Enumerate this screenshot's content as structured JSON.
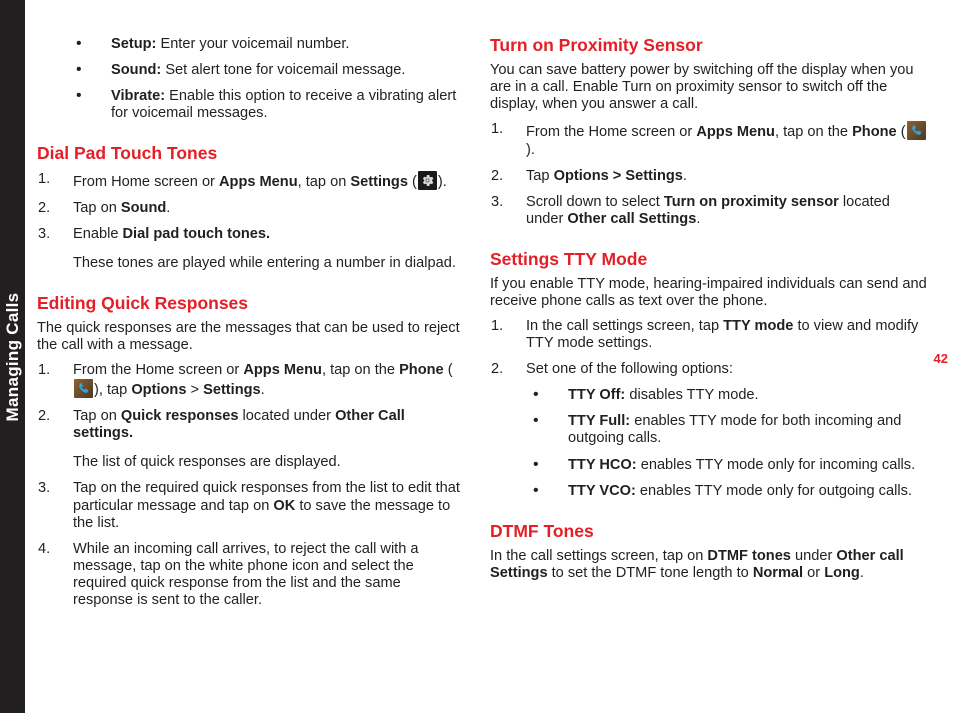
{
  "side_tab": {
    "label": "Managing Calls"
  },
  "page_number": "42",
  "colors": {
    "heading_red": "#e32028",
    "tab_black": "#231f20",
    "body_black": "#231f20"
  },
  "icons": {
    "gear": "gear-icon",
    "phone": "phone-icon"
  },
  "left_column": {
    "voicemail_bullets": [
      {
        "term": "Setup:",
        "rest": " Enter your voicemail number."
      },
      {
        "term": "Sound:",
        "rest": " Set alert tone for voicemail message."
      },
      {
        "term": "Vibrate:",
        "rest": " Enable this option to receive a vibrating alert for voicemail messages."
      }
    ],
    "dial_pad": {
      "heading": "Dial Pad Touch Tones",
      "step1_a": "From Home screen or ",
      "step1_b": "Apps Menu",
      "step1_c": ", tap on ",
      "step1_d": "Settings",
      "step1_e": " (",
      "step1_f": ").",
      "step1_num": "1.",
      "step2_num": "2.",
      "step2_a": "Tap on ",
      "step2_b": "Sound",
      "step2_c": ".",
      "step3_num": "3.",
      "step3_a": "Enable ",
      "step3_b": "Dial pad touch tones.",
      "note": "These tones are played while entering a number in dialpad."
    },
    "quick_responses": {
      "heading": "Editing Quick Responses",
      "intro": "The quick responses are the messages that can be used to reject the call with a message.",
      "step1_num": "1.",
      "step1_a": "From the Home screen or ",
      "step1_b": "Apps Menu",
      "step1_c": ", tap on the ",
      "step1_d": "Phone",
      "step1_e": " (",
      "step1_f": "), tap ",
      "step1_g": "Options",
      "step1_h": " > ",
      "step1_i": "Settings",
      "step1_j": ".",
      "step2_num": "2.",
      "step2_a": "Tap on ",
      "step2_b": "Quick responses",
      "step2_c": " located under ",
      "step2_d": "Other Call settings.",
      "note": "The list of quick responses are displayed.",
      "step3_num": "3.",
      "step3_a": "Tap on the required quick responses from the list to edit that particular message and tap on ",
      "step3_b": "OK",
      "step3_c": " to save the message to the list.",
      "step4_num": "4.",
      "step4_a": "While an incoming call arrives, to reject the call with a message, tap on the white phone icon and select the required quick response from the list and the same response is sent to the caller."
    }
  },
  "right_column": {
    "proximity": {
      "heading": "Turn on Proximity Sensor",
      "intro": "You can save battery power by switching off the display when you are in a call. Enable Turn on proximity sensor to switch off the display, when you answer a call.",
      "step1_num": "1.",
      "step1_a": "From the Home screen or ",
      "step1_b": "Apps Menu",
      "step1_c": ", tap on the ",
      "step1_d": "Phone",
      "step1_e": " (",
      "step1_f": ").",
      "step2_num": "2.",
      "step2_a": "Tap ",
      "step2_b": "Options > Settings",
      "step2_c": ".",
      "step3_num": "3.",
      "step3_a": "Scroll down to select ",
      "step3_b": "Turn on proximity sensor",
      "step3_c": " located under ",
      "step3_d": "Other call Settings",
      "step3_e": "."
    },
    "tty": {
      "heading": "Settings TTY Mode",
      "intro": "If you enable TTY mode, hearing-impaired individuals can send and receive phone calls as text over the phone.",
      "step1_num": "1.",
      "step1_a": "In the call settings screen, tap ",
      "step1_b": "TTY mode",
      "step1_c": " to view and modify TTY mode settings.",
      "step2_num": "2.",
      "step2_a": "Set one of the following options:",
      "options": [
        {
          "term": "TTY Off:",
          "rest": " disables TTY mode."
        },
        {
          "term": "TTY Full:",
          "rest": " enables TTY mode for both incoming and outgoing calls."
        },
        {
          "term": "TTY HCO:",
          "rest": " enables TTY mode only for incoming calls."
        },
        {
          "term": "TTY VCO:",
          "rest": " enables TTY mode only for outgoing calls."
        }
      ]
    },
    "dtmf": {
      "heading": "DTMF Tones",
      "p_a": "In the call settings screen, tap on ",
      "p_b": "DTMF tones",
      "p_c": " under ",
      "p_d": "Other call Settings",
      "p_e": " to set the DTMF tone length to ",
      "p_f": "Normal",
      "p_g": " or ",
      "p_h": "Long",
      "p_i": "."
    }
  }
}
